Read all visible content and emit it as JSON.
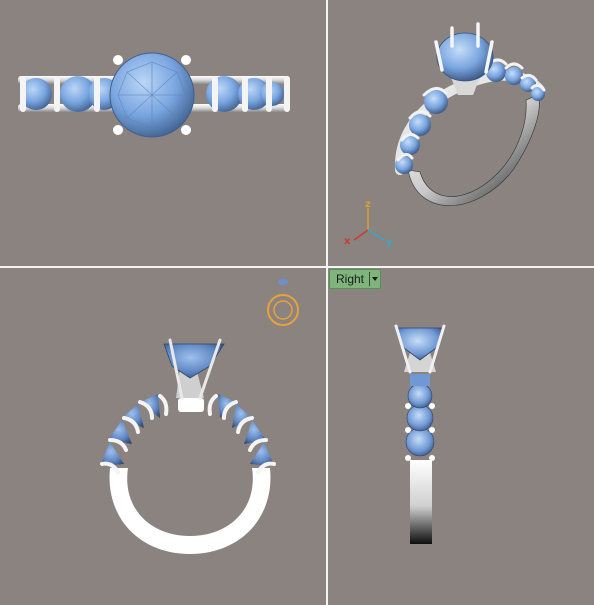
{
  "viewports": {
    "top": {},
    "perspective": {
      "axis": {
        "x": "x",
        "y": "y",
        "z": "z"
      },
      "colors": {
        "x": "#cc3a2e",
        "y": "#3aa6c8",
        "z": "#d8a030"
      }
    },
    "front": {},
    "right": {
      "label": "Right"
    }
  },
  "colors": {
    "background": "#8a8380",
    "gem": "#7aa6e0",
    "gem_dark": "#3f5f8e",
    "metal": "#f2f2f2",
    "metal_shadow": "#9a9a9a",
    "divider": "#f4f4f4",
    "label_tab": "#7fb57c",
    "orbit_widget": "#e8a23a"
  }
}
